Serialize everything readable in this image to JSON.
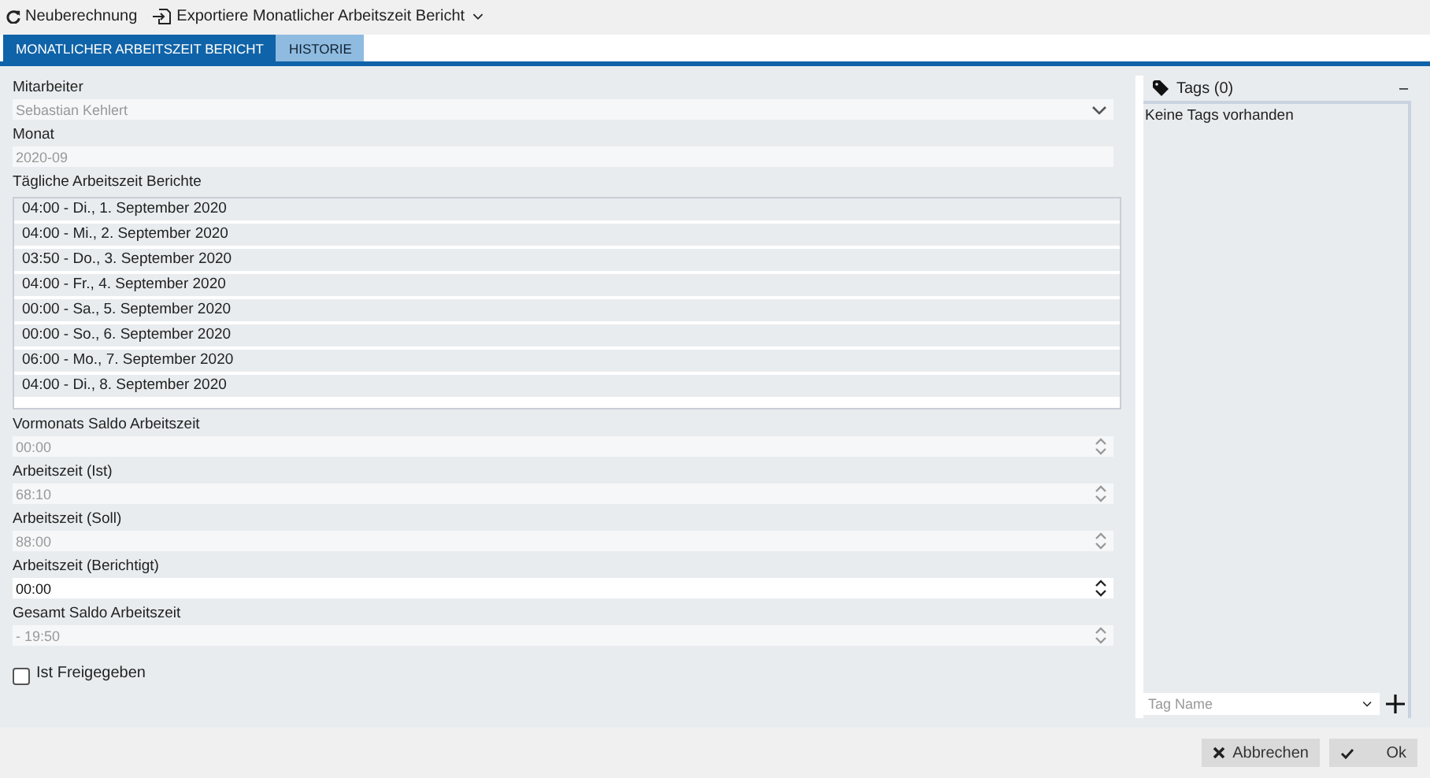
{
  "toolbar": [
    {
      "kind": "refresh",
      "label": "Neuberechnung"
    },
    {
      "kind": "export",
      "label": "Exportiere Monatlicher Arbeitszeit Bericht"
    }
  ],
  "tabs": [
    {
      "label": "MONATLICHER ARBEITSZEIT BERICHT",
      "selected": true
    },
    {
      "label": "HISTORIE",
      "selected": false
    }
  ],
  "form": {
    "top_fields": [
      {
        "kind": "select",
        "label": "Mitarbeiter",
        "value": "Sebastian Kehlert",
        "disabled": true
      },
      {
        "kind": "text",
        "label": "Monat",
        "value": "2020-09",
        "disabled": true
      }
    ],
    "daily_reports": {
      "label": "Tägliche Arbeitszeit Berichte",
      "items": [
        "04:00 - Di., 1. September 2020",
        "04:00 - Mi., 2. September 2020",
        "03:50 - Do., 3. September 2020",
        "04:00 - Fr., 4. September 2020",
        "00:00 - Sa., 5. September 2020",
        "00:00 - So., 6. September 2020",
        "06:00 - Mo., 7. September 2020",
        "04:00 - Di., 8. September 2020"
      ]
    },
    "number_fields": [
      {
        "label": "Vormonats Saldo Arbeitszeit",
        "value": "00:00",
        "disabled": true
      },
      {
        "label": "Arbeitszeit (Ist)",
        "value": "68:10",
        "disabled": true
      },
      {
        "label": "Arbeitszeit (Soll)",
        "value": "88:00",
        "disabled": true
      },
      {
        "label": "Arbeitszeit (Berichtigt)",
        "value": "00:00",
        "disabled": false
      },
      {
        "label": "Gesamt Saldo Arbeitszeit",
        "value": "- 19:50",
        "disabled": true
      }
    ],
    "released": {
      "label": "Ist Freigegeben",
      "checked": false
    }
  },
  "tags": {
    "title": "Tags (0)",
    "collapse": "–",
    "empty_text": "Keine Tags vorhanden",
    "input": {
      "placeholder": "Tag Name"
    }
  },
  "buttons": [
    {
      "kind": "cancel",
      "label": "Abbrechen"
    },
    {
      "kind": "ok",
      "label": "Ok"
    }
  ]
}
